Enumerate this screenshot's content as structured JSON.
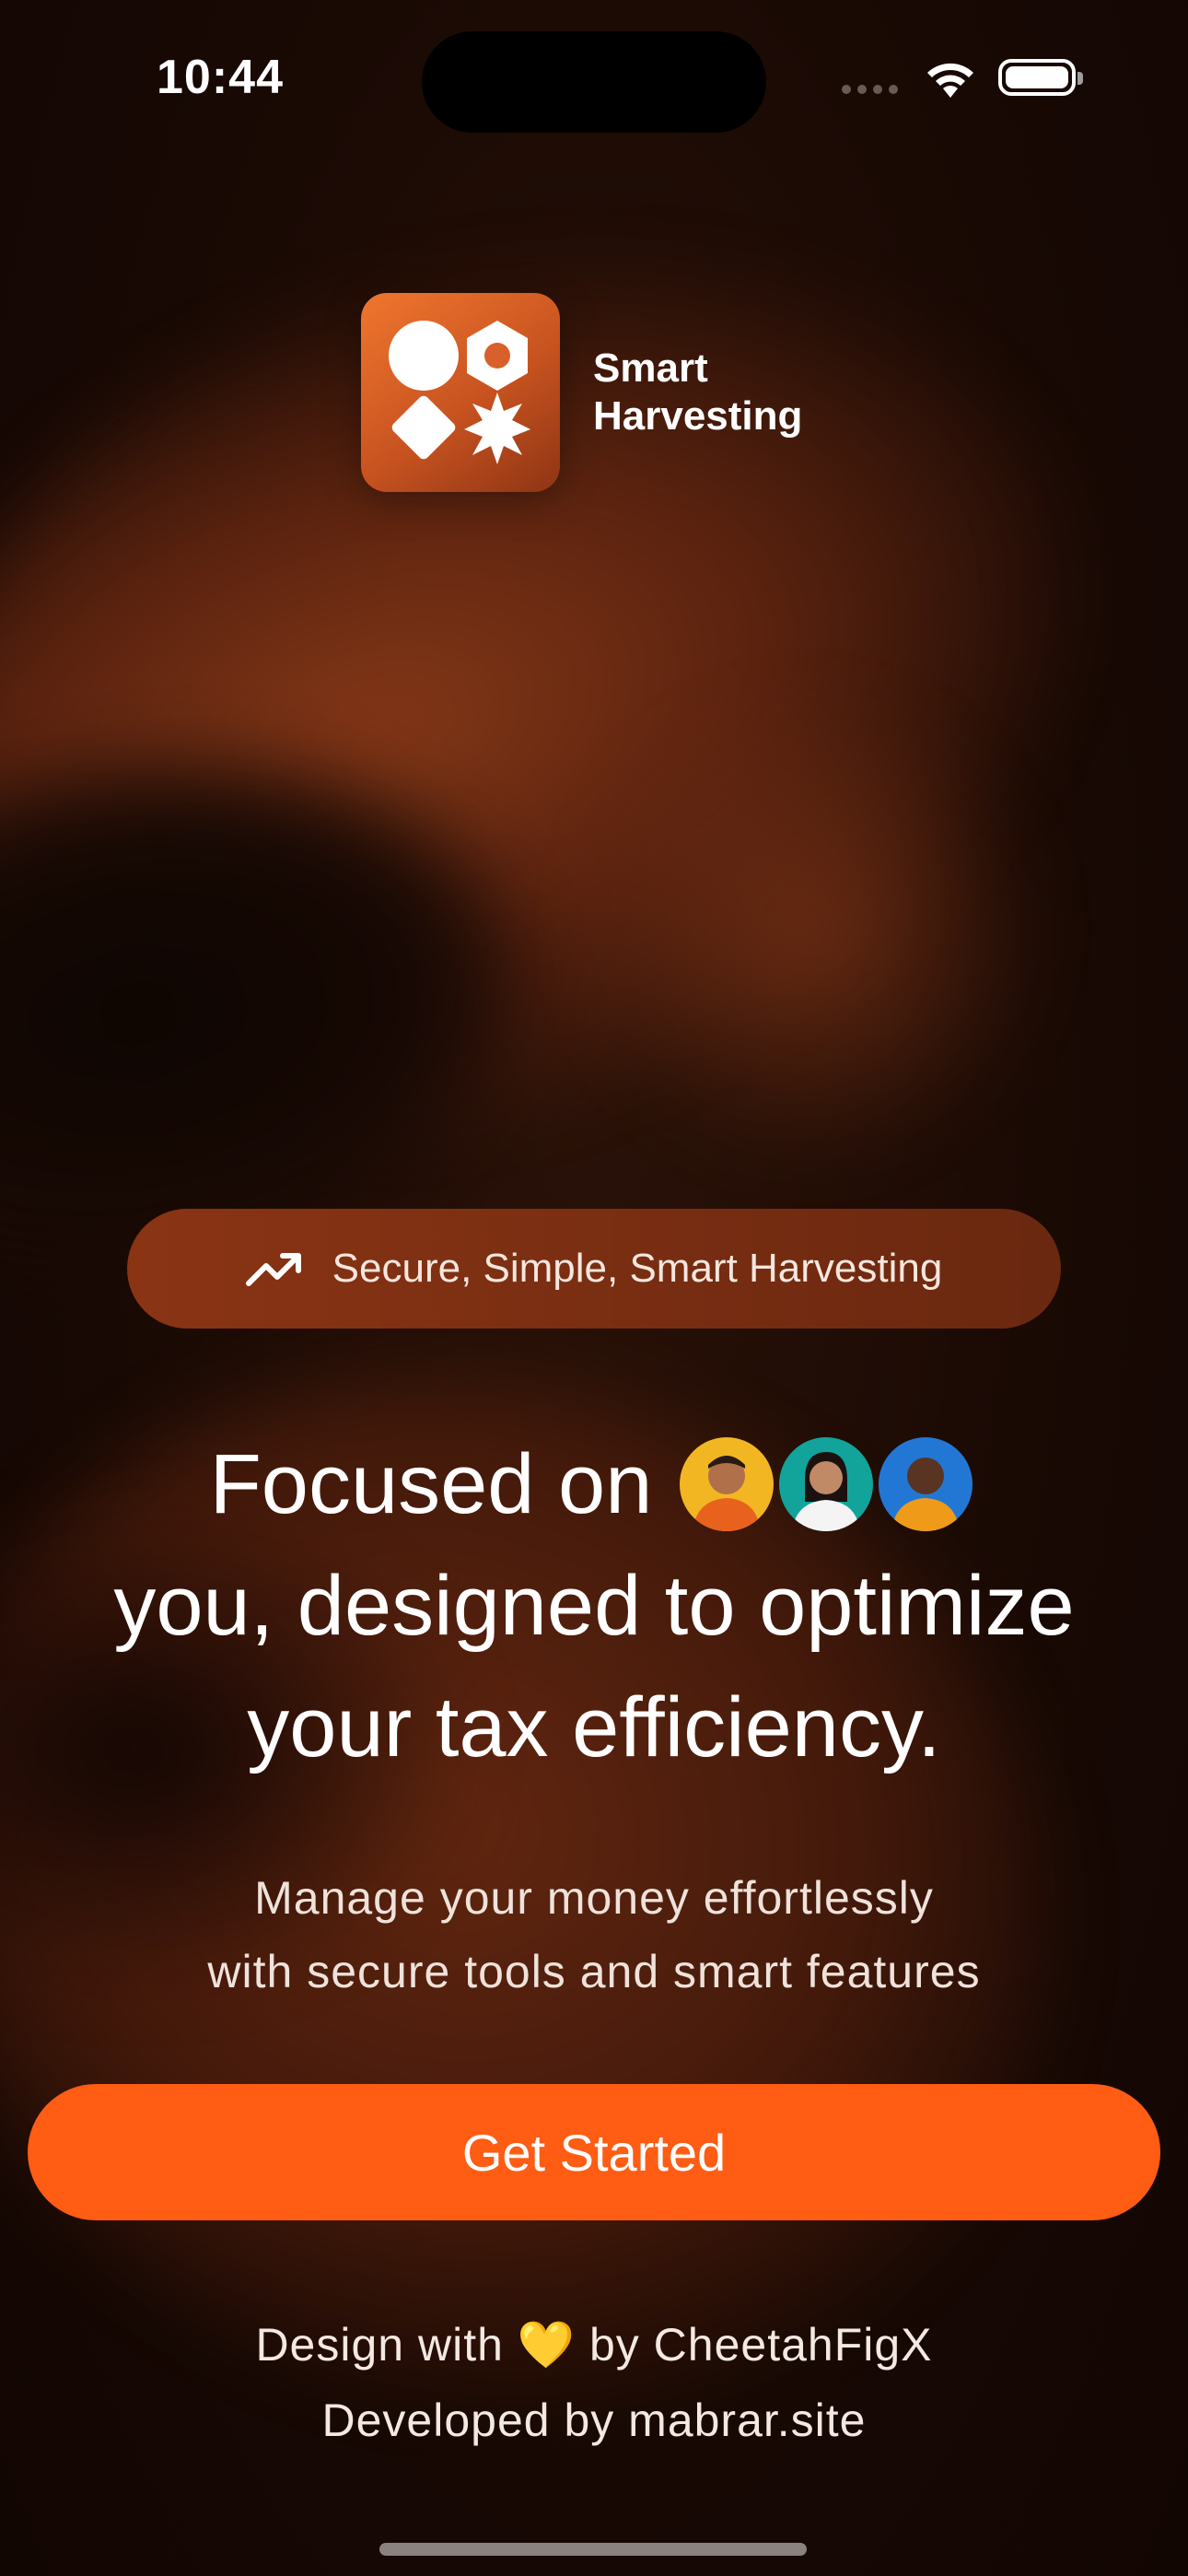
{
  "status_bar": {
    "time": "10:44"
  },
  "brand": {
    "logo_line1": "Smart",
    "logo_line2": "Harvesting",
    "accent_color": "#ff5c14"
  },
  "tagline_pill": {
    "icon": "trending-up-icon",
    "text": "Secure, Simple, Smart Harvesting"
  },
  "headline": {
    "line1": "Focused on",
    "line2": "you, designed to optimize",
    "line3": "your tax efficiency."
  },
  "subtitle": {
    "line1": "Manage your money effortlessly",
    "line2": "with secure tools and smart features"
  },
  "cta": {
    "label": "Get Started"
  },
  "footer": {
    "design_prefix": "Design with",
    "heart": "💛",
    "design_suffix": "by CheetahFigX",
    "developed": "Developed by mabrar.site"
  }
}
